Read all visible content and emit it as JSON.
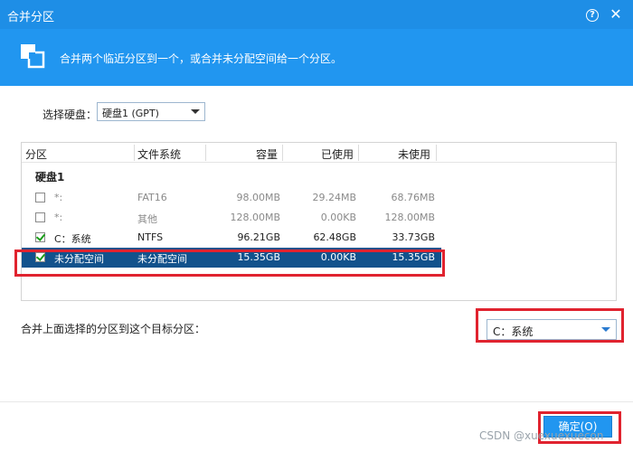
{
  "window": {
    "title": "合并分区",
    "help_glyph": "?",
    "close_glyph": "✕"
  },
  "banner": {
    "description": "合并两个临近分区到一个，或合并未分配空间给一个分区。"
  },
  "disk_selector": {
    "label": "选择硬盘：",
    "selected": "硬盘1 (GPT)"
  },
  "table": {
    "headers": [
      "分区",
      "文件系统",
      "容量",
      "已使用",
      "未使用"
    ],
    "group": "硬盘1",
    "rows": [
      {
        "name": "*:",
        "fs": "FAT16",
        "capacity": "98.00MB",
        "used": "29.24MB",
        "free": "68.76MB",
        "checked": false
      },
      {
        "name": "*:",
        "fs": "其他",
        "capacity": "128.00MB",
        "used": "0.00KB",
        "free": "128.00MB",
        "checked": false
      },
      {
        "name": "C：系统",
        "fs": "NTFS",
        "capacity": "96.21GB",
        "used": "62.48GB",
        "free": "33.73GB",
        "checked": true
      },
      {
        "name": "未分配空间",
        "fs": "未分配空间",
        "capacity": "15.35GB",
        "used": "0.00KB",
        "free": "15.35GB",
        "checked": true
      }
    ]
  },
  "target": {
    "label": "合并上面选择的分区到这个目标分区：",
    "selected": "C：系统"
  },
  "footer": {
    "ok_label": "确定(O)"
  },
  "watermark": "CSDN @xuexuexuecon",
  "colors": {
    "titlebar": "#1e8ee6",
    "banner": "#2196f0",
    "selected_row": "#12528c",
    "highlight": "#e0232f"
  }
}
